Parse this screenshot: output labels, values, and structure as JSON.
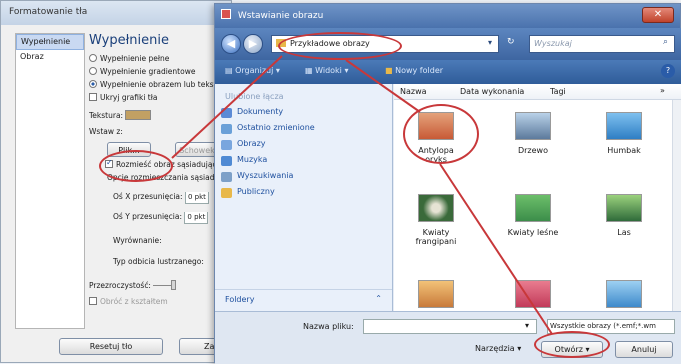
{
  "format_dialog": {
    "title": "Formatowanie tła",
    "nav": [
      "Wypełnienie",
      "Obraz"
    ],
    "heading": "Wypełnienie",
    "options": [
      {
        "label": "Wypełnienie pełne",
        "checked": false
      },
      {
        "label": "Wypełnienie gradientowe",
        "checked": false
      },
      {
        "label": "Wypełnienie obrazem lub tekstur",
        "checked": true
      },
      {
        "label": "Ukryj grafiki tła",
        "checked": false
      }
    ],
    "texture_label": "Tekstura:",
    "insert_from_label": "Wstaw z:",
    "file_button": "Plik...",
    "clipboard_button": "Schowek",
    "tile_checkbox": "Rozmieść obraz sąsiadująco",
    "tiling_options_label": "Opcje rozmieszczania sąsiadująco",
    "offset_x_label": "Oś X przesunięcia:",
    "offset_x_value": "0 pkt",
    "offset_y_label": "Oś Y przesunięcia:",
    "offset_y_value": "0 pkt",
    "alignment_label": "Wyrównanie:",
    "mirror_label": "Typ odbicia lustrzanego:",
    "transparency_label": "Przezroczystość:",
    "rotate_label": "Obróć z kształtem",
    "reset_button": "Resetuj tło",
    "close_button_partial": "Za"
  },
  "insert_dialog": {
    "title": "Wstawianie obrazu",
    "address": "Przykładowe obrazy",
    "search_placeholder": "Wyszukaj",
    "toolbar": {
      "organize": "Organizuj",
      "views": "Widoki",
      "new_folder": "Nowy folder"
    },
    "favorites_header": "Ulubione łącza",
    "favorites": [
      {
        "label": "Dokumenty",
        "icon": "documents-icon",
        "color": "#5b8ad6"
      },
      {
        "label": "Ostatnio zmienione",
        "icon": "recent-icon",
        "color": "#6aa0d8"
      },
      {
        "label": "Obrazy",
        "icon": "pictures-icon",
        "color": "#79a6de"
      },
      {
        "label": "Muzyka",
        "icon": "music-icon",
        "color": "#4f8ad4"
      },
      {
        "label": "Wyszukiwania",
        "icon": "search-folder-icon",
        "color": "#7da0c8"
      },
      {
        "label": "Publiczny",
        "icon": "public-folder-icon",
        "color": "#e8b84a"
      }
    ],
    "folders_label": "Foldery",
    "columns": [
      "Nazwa",
      "Data wykonania",
      "Tagi"
    ],
    "files": [
      {
        "name": "Antylopa oryks",
        "color": "#c85a36"
      },
      {
        "name": "Drzewo",
        "color": "#5c7a9c"
      },
      {
        "name": "Humbak",
        "color": "#2e7ec4"
      },
      {
        "name": "Kwiaty frangipani",
        "color": "#3a6a3a"
      },
      {
        "name": "Kwiaty leśne",
        "color": "#3c8d4a"
      },
      {
        "name": "Las",
        "color": "#2f6b3a"
      },
      {
        "name": "",
        "color": "#c87a3a"
      },
      {
        "name": "",
        "color": "#c23b5a"
      },
      {
        "name": "",
        "color": "#3e8acb"
      }
    ],
    "filename_label": "Nazwa pliku:",
    "filetype_value": "Wszystkie obrazy (*.emf;*.wm",
    "tools_label": "Narzędzia",
    "open_button": "Otwórz",
    "cancel_button": "Anuluj"
  },
  "annotation_color": "#c8383a"
}
